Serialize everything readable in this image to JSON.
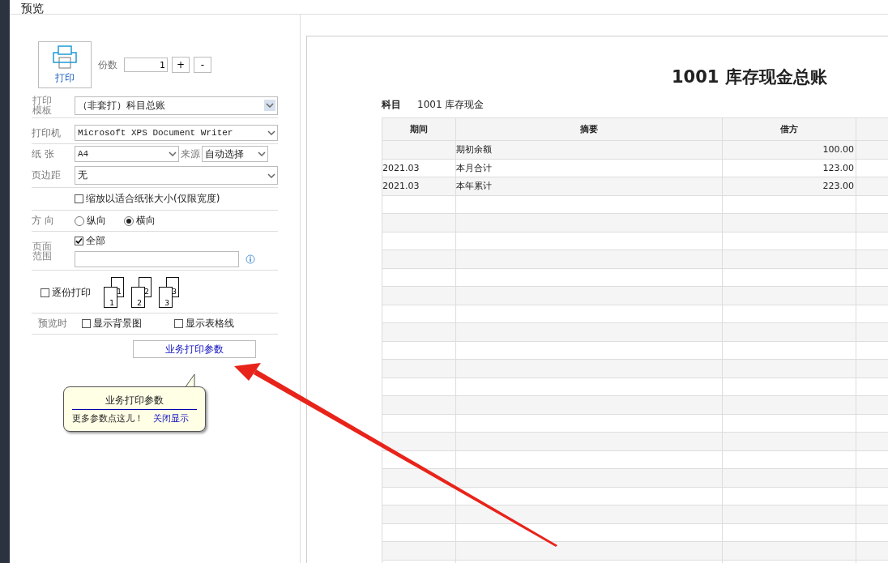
{
  "window": {
    "title": "预览"
  },
  "print_button": {
    "label": "打印"
  },
  "copies": {
    "label": "份数",
    "value": "1",
    "buttons": [
      "+",
      "-"
    ]
  },
  "template": {
    "label": "打印模板",
    "value": "（非套打）科目总账"
  },
  "printer": {
    "label": "打印机",
    "value": "Microsoft XPS Document Writer"
  },
  "paper": {
    "label": "纸 张",
    "value": "A4",
    "source_label": "来源",
    "source_value": "自动选择"
  },
  "margin": {
    "label": "页边距",
    "value": "无"
  },
  "fit_width": {
    "label": "缩放以适合纸张大小(仅限宽度)",
    "checked": false
  },
  "orientation": {
    "label": "方 向",
    "options": [
      {
        "label": "纵向",
        "selected": false
      },
      {
        "label": "横向",
        "selected": true
      }
    ]
  },
  "page_range": {
    "label": "页面范围",
    "all": {
      "label": "全部",
      "checked": true
    }
  },
  "collate": {
    "label": "逐份打印",
    "checked": false,
    "sets": [
      {
        "back": "1",
        "front": "1"
      },
      {
        "back": "2",
        "front": "2"
      },
      {
        "back": "3",
        "front": "3"
      }
    ]
  },
  "preview_options": {
    "label": "预览时",
    "items": [
      {
        "label": "显示背景图",
        "checked": false
      },
      {
        "label": "显示表格线",
        "checked": false
      }
    ]
  },
  "params_button": {
    "label": "业务打印参数"
  },
  "tooltip": {
    "title": "业务打印参数",
    "text": "更多参数点这儿！",
    "link": "关闭显示"
  },
  "report": {
    "title": "1001 库存现金总账",
    "subject_label": "科目",
    "subject_value": "1001 库存现金",
    "columns": [
      "期间",
      "摘要",
      "借方"
    ],
    "rows": [
      [
        "",
        "期初余额",
        "100.00"
      ],
      [
        "2021.03",
        "本月合计",
        "123.00"
      ],
      [
        "2021.03",
        "本年累计",
        "223.00"
      ]
    ]
  }
}
